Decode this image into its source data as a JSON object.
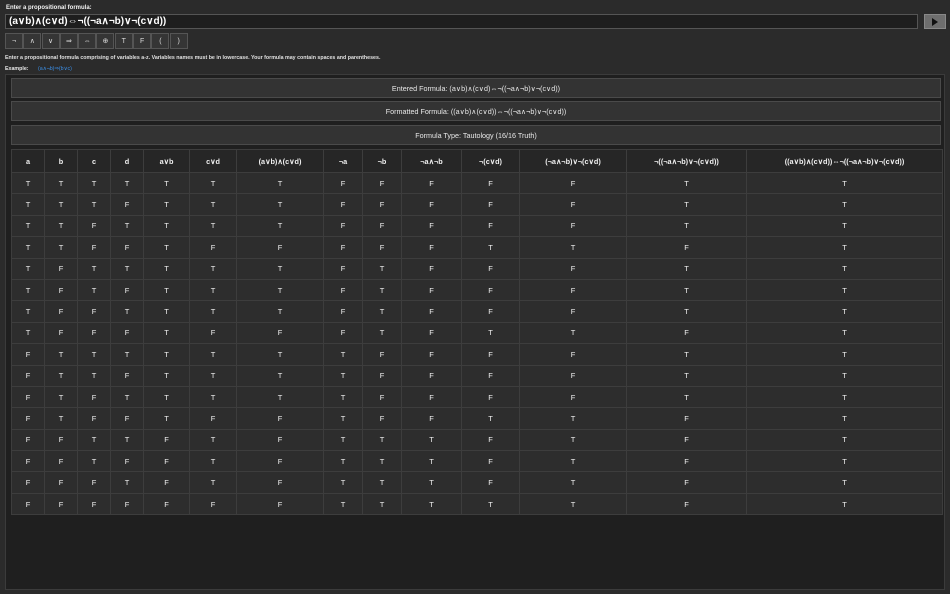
{
  "input_label": "Enter a propositional formula:",
  "formula_value": "(a∨b)∧(c∨d)⇔¬((¬a∧¬b)∨¬(c∨d))",
  "symbols": [
    "¬",
    "∧",
    "∨",
    "⇒",
    "⇔",
    "⊕",
    "T",
    "F",
    "(",
    ")"
  ],
  "help_text": "Enter a propositional formula comprising of variables a-z. Variables names must be in lowercase. Your formula may contain spaces and parentheses.",
  "example_label": "Example:",
  "example_link": "(a∧¬b)⇒(b∨c)",
  "entered_formula": "Entered Formula: (a∨b)∧(c∨d)⇔¬((¬a∧¬b)∨¬(c∨d))",
  "formatted_formula": "Formatted Formula: ((a∨b)∧(c∨d))⇔¬((¬a∧¬b)∨¬(c∨d))",
  "formula_type": "Formula Type: Tautology (16/16 Truth)",
  "table": {
    "headers": [
      "a",
      "b",
      "c",
      "d",
      "a∨b",
      "c∨d",
      "(a∨b)∧(c∨d)",
      "¬a",
      "¬b",
      "¬a∧¬b",
      "¬(c∨d)",
      "(¬a∧¬b)∨¬(c∨d)",
      "¬((¬a∧¬b)∨¬(c∨d))",
      "((a∨b)∧(c∨d))⇔¬((¬a∧¬b)∨¬(c∨d))"
    ],
    "rows": [
      [
        "T",
        "T",
        "T",
        "T",
        "T",
        "T",
        "T",
        "F",
        "F",
        "F",
        "F",
        "F",
        "T",
        "T"
      ],
      [
        "T",
        "T",
        "T",
        "F",
        "T",
        "T",
        "T",
        "F",
        "F",
        "F",
        "F",
        "F",
        "T",
        "T"
      ],
      [
        "T",
        "T",
        "F",
        "T",
        "T",
        "T",
        "T",
        "F",
        "F",
        "F",
        "F",
        "F",
        "T",
        "T"
      ],
      [
        "T",
        "T",
        "F",
        "F",
        "T",
        "F",
        "F",
        "F",
        "F",
        "F",
        "T",
        "T",
        "F",
        "T"
      ],
      [
        "T",
        "F",
        "T",
        "T",
        "T",
        "T",
        "T",
        "F",
        "T",
        "F",
        "F",
        "F",
        "T",
        "T"
      ],
      [
        "T",
        "F",
        "T",
        "F",
        "T",
        "T",
        "T",
        "F",
        "T",
        "F",
        "F",
        "F",
        "T",
        "T"
      ],
      [
        "T",
        "F",
        "F",
        "T",
        "T",
        "T",
        "T",
        "F",
        "T",
        "F",
        "F",
        "F",
        "T",
        "T"
      ],
      [
        "T",
        "F",
        "F",
        "F",
        "T",
        "F",
        "F",
        "F",
        "T",
        "F",
        "T",
        "T",
        "F",
        "T"
      ],
      [
        "F",
        "T",
        "T",
        "T",
        "T",
        "T",
        "T",
        "T",
        "F",
        "F",
        "F",
        "F",
        "T",
        "T"
      ],
      [
        "F",
        "T",
        "T",
        "F",
        "T",
        "T",
        "T",
        "T",
        "F",
        "F",
        "F",
        "F",
        "T",
        "T"
      ],
      [
        "F",
        "T",
        "F",
        "T",
        "T",
        "T",
        "T",
        "T",
        "F",
        "F",
        "F",
        "F",
        "T",
        "T"
      ],
      [
        "F",
        "T",
        "F",
        "F",
        "T",
        "F",
        "F",
        "T",
        "F",
        "F",
        "T",
        "T",
        "F",
        "T"
      ],
      [
        "F",
        "F",
        "T",
        "T",
        "F",
        "T",
        "F",
        "T",
        "T",
        "T",
        "F",
        "T",
        "F",
        "T"
      ],
      [
        "F",
        "F",
        "T",
        "F",
        "F",
        "T",
        "F",
        "T",
        "T",
        "T",
        "F",
        "T",
        "F",
        "T"
      ],
      [
        "F",
        "F",
        "F",
        "T",
        "F",
        "T",
        "F",
        "T",
        "T",
        "T",
        "F",
        "T",
        "F",
        "T"
      ],
      [
        "F",
        "F",
        "F",
        "F",
        "F",
        "F",
        "F",
        "T",
        "T",
        "T",
        "T",
        "T",
        "F",
        "T"
      ]
    ]
  }
}
